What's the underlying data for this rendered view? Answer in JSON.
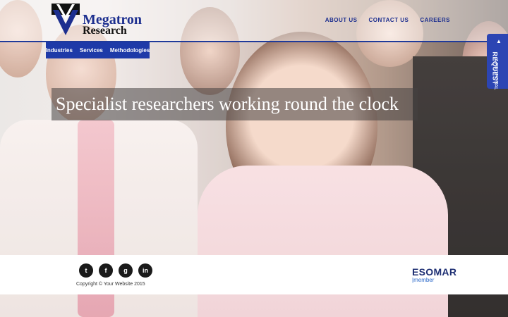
{
  "brand": {
    "name_line1": "Megatron",
    "name_line2": "Research"
  },
  "top_nav": [
    "ABOUT US",
    "CONTACT US",
    "CAREERS"
  ],
  "sub_nav": [
    "Industries",
    "Services",
    "Methodologies"
  ],
  "hero": {
    "headline": "Specialist researchers working round the clock"
  },
  "proposal_tab": {
    "line1": "REQUEST",
    "line2": "A PROPOSAL",
    "arrow": "▲"
  },
  "footer": {
    "social_icons": [
      "twitter-icon",
      "facebook-icon",
      "google-plus-icon",
      "linkedin-icon"
    ],
    "social_glyphs": [
      "t",
      "f",
      "g",
      "in"
    ],
    "copyright": "Copyright © Your Website 2015",
    "esomar": "ESOMAR",
    "esomar_sub": "|member"
  },
  "colors": {
    "brand_blue": "#1e3aa8",
    "headline_bg": "#464141"
  }
}
